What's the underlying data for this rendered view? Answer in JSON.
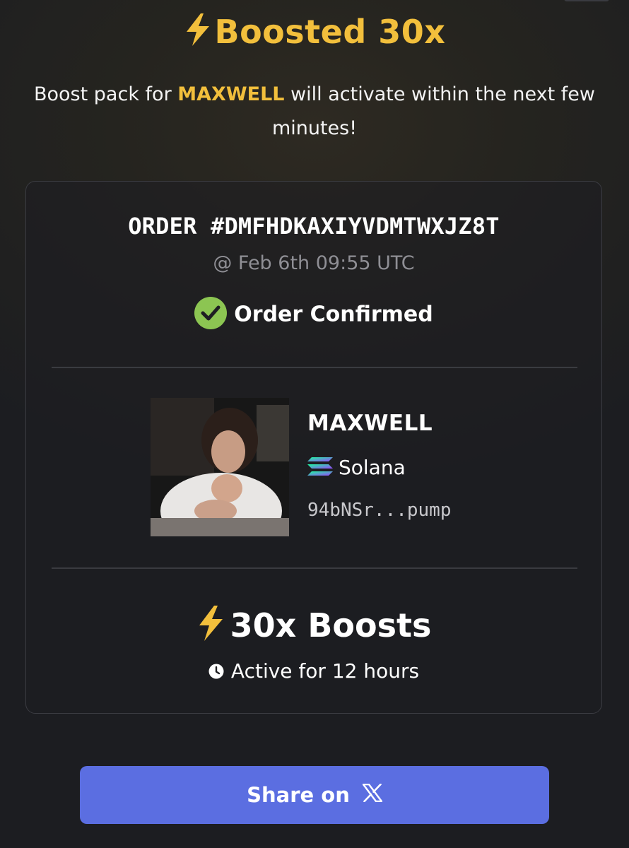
{
  "header": {
    "title": "Boosted 30x",
    "title_icon": "lightning-bolt-icon",
    "subtitle_before": "Boost pack for ",
    "subtitle_token": "MAXWELL",
    "subtitle_after": " will activate within the next few minutes!"
  },
  "order": {
    "id_label": "ORDER #DMFHDKAXIYVDMTWXJZ8T",
    "timestamp": "@ Feb 6th 09:55 UTC",
    "status": "Order Confirmed",
    "status_icon": "check-circle-icon",
    "status_color": "#8cc552"
  },
  "token": {
    "name": "MAXWELL",
    "chain": "Solana",
    "chain_icon": "solana-icon",
    "address": "94bNSr...pump",
    "image": "token-avatar-photo"
  },
  "boost": {
    "amount": "30x Boosts",
    "duration": "Active for 12 hours",
    "icon": "lightning-bolt-icon",
    "duration_icon": "clock-icon"
  },
  "actions": {
    "share_label": "Share on",
    "share_icon": "x-logo-icon"
  },
  "colors": {
    "accent": "#f2bf3c",
    "button": "#5b6ee1",
    "background": "#1c1d21"
  }
}
